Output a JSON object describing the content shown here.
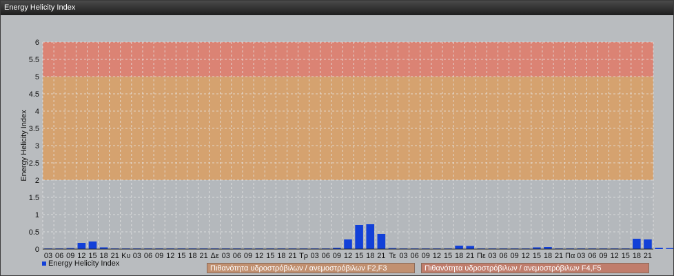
{
  "window": {
    "title": "Energy Helicity Index"
  },
  "legend": {
    "series_label": "Energy Helicity Index"
  },
  "zones": [
    {
      "label": "Πιθανότητα υδροστρόβιλων / ανεμοστρόβιλων F2,F3",
      "from": 2,
      "to": 5,
      "color": "#d7a06a"
    },
    {
      "label": "Πιθανότητα υδροστρόβιλων / ανεμοστρόβιλων F4,F5",
      "from": 5,
      "to": 6,
      "color": "#dd8070"
    }
  ],
  "chart_data": {
    "type": "bar",
    "title": "",
    "xlabel": "",
    "ylabel": "Energy Helicity Index",
    "ylim": [
      0,
      6
    ],
    "yticks": [
      0,
      0.5,
      1,
      1.5,
      2,
      2.5,
      3,
      3.5,
      4,
      4.5,
      5,
      5.5,
      6
    ],
    "grid": true,
    "legend_position": "bottom-left",
    "bar_color": "#1240d8",
    "categories": [
      "03",
      "06",
      "09",
      "12",
      "15",
      "18",
      "21",
      "Κυ",
      "03",
      "06",
      "09",
      "12",
      "15",
      "18",
      "21",
      "Δε",
      "03",
      "06",
      "09",
      "12",
      "15",
      "18",
      "21",
      "Τρ",
      "03",
      "06",
      "09",
      "12",
      "15",
      "18",
      "21",
      "Τε",
      "03",
      "06",
      "09",
      "12",
      "15",
      "18",
      "21",
      "Πε",
      "03",
      "06",
      "09",
      "12",
      "15",
      "18",
      "21",
      "Πα",
      "03",
      "06",
      "09",
      "12",
      "15",
      "18",
      "21"
    ],
    "series": [
      {
        "name": "Energy Helicity Index",
        "values": [
          0.02,
          0.02,
          0.03,
          0.18,
          0.22,
          0.05,
          0.02,
          0.02,
          0.02,
          0.02,
          0.02,
          0.02,
          0.02,
          0.02,
          0.02,
          0.02,
          0.02,
          0.02,
          0.02,
          0.02,
          0.02,
          0.02,
          0.02,
          0.02,
          0.02,
          0.02,
          0.04,
          0.28,
          0.7,
          0.72,
          0.44,
          0.03,
          0.02,
          0.02,
          0.02,
          0.02,
          0.02,
          0.1,
          0.09,
          0.02,
          0.02,
          0.02,
          0.02,
          0.02,
          0.05,
          0.06,
          0.02,
          0.02,
          0.02,
          0.02,
          0.02,
          0.02,
          0.02,
          0.3,
          0.28,
          0.04,
          0.03
        ]
      }
    ]
  }
}
